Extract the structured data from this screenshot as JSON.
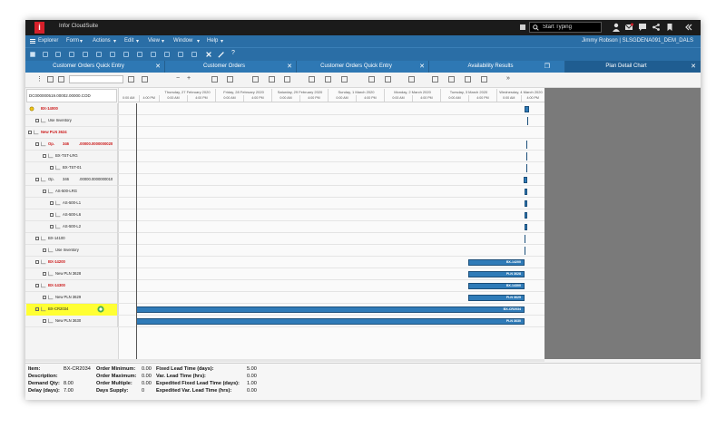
{
  "app": {
    "title": "Infor CloudSuite",
    "search_placeholder": "Start Typing",
    "user": "Jimmy Robson | SLSGDENA091_DEM_DALS"
  },
  "menu": [
    "Explorer",
    "Form",
    "Actions",
    "Edit",
    "View",
    "Window",
    "Help"
  ],
  "tabs": [
    {
      "label": "Customer Orders Quick Entry",
      "active": false
    },
    {
      "label": "Customer Orders",
      "active": false
    },
    {
      "label": "Customer Orders Quick Entry",
      "active": false
    },
    {
      "label": "Availability Results",
      "active": false
    },
    {
      "label": "Plan Detail Chart",
      "active": true
    }
  ],
  "tree_header": "DC000000519.00002.00000.COD",
  "dates": [
    "Thursday, 27 February 2020",
    "Friday, 28 February 2020",
    "Saturday, 29 February 2020",
    "Sunday, 1 March 2020",
    "Monday, 2 March 2020",
    "Tuesday, 3 March 2020",
    "Wednesday, 4 March 2020"
  ],
  "times": [
    "0:00 AM",
    "4:00 PM"
  ],
  "rows": [
    {
      "label": "BX-14000",
      "style": "red"
    },
    {
      "label": "Use Inventory",
      "style": "plain"
    },
    {
      "label": "New PLN 3624",
      "style": "red"
    },
    {
      "label": "Op.",
      "qty": "346",
      "val": ".00000.0000000020",
      "style": "redop"
    },
    {
      "label": "BX-TST-LRG",
      "style": "plain"
    },
    {
      "label": "BX-TST-01",
      "style": "plain"
    },
    {
      "label": "Op.",
      "qty": "346",
      "val": ".00000.0000000010",
      "style": "op"
    },
    {
      "label": "AS-500-LRG",
      "style": "plain"
    },
    {
      "label": "AS-500-L1",
      "style": "plain"
    },
    {
      "label": "AS-500-L6",
      "style": "plain"
    },
    {
      "label": "AS-500-L2",
      "style": "plain"
    },
    {
      "label": "BX-14100",
      "style": "plain"
    },
    {
      "label": "Use Inventory",
      "style": "plain"
    },
    {
      "label": "BX-14200",
      "style": "red2"
    },
    {
      "label": "New PLN 3628",
      "style": "plain"
    },
    {
      "label": "BX-14300",
      "style": "red2"
    },
    {
      "label": "New PLN 3629",
      "style": "plain"
    },
    {
      "label": "BX-CR2034",
      "style": "hl"
    },
    {
      "label": "New PLN 3630",
      "style": "plain"
    }
  ],
  "bars": [
    {
      "row": 13,
      "label": "BX-14200"
    },
    {
      "row": 14,
      "label": "PLN 3628"
    },
    {
      "row": 15,
      "label": "BX-14300"
    },
    {
      "row": 16,
      "label": "PLN 3629"
    },
    {
      "row": 17,
      "label": "BX-CR2034"
    },
    {
      "row": 18,
      "label": "PLN 3630"
    }
  ],
  "footer": {
    "item_label": "Item:",
    "item": "BX-CR2034",
    "desc_label": "Description:",
    "desc": "",
    "demand_label": "Demand Qty:",
    "demand": "8.00",
    "delay_label": "Delay (days):",
    "delay": "7.00",
    "omin_label": "Order Minimum:",
    "omin": "0.00",
    "omax_label": "Order Maximum:",
    "omax": "0.00",
    "omul_label": "Order Multiple:",
    "omul": "0.00",
    "dsup_label": "Days Supply:",
    "dsup": "0",
    "flt_label": "Fixed Lead Time (days):",
    "flt": "5.00",
    "vlt_label": "Var. Lead Time (hrs):",
    "vlt": "0.00",
    "eflt_label": "Expedited Fixed Lead Time (days):",
    "eflt": "1.00",
    "evlt_label": "Expedited Var. Lead Time (hrs):",
    "evlt": "0.00"
  }
}
